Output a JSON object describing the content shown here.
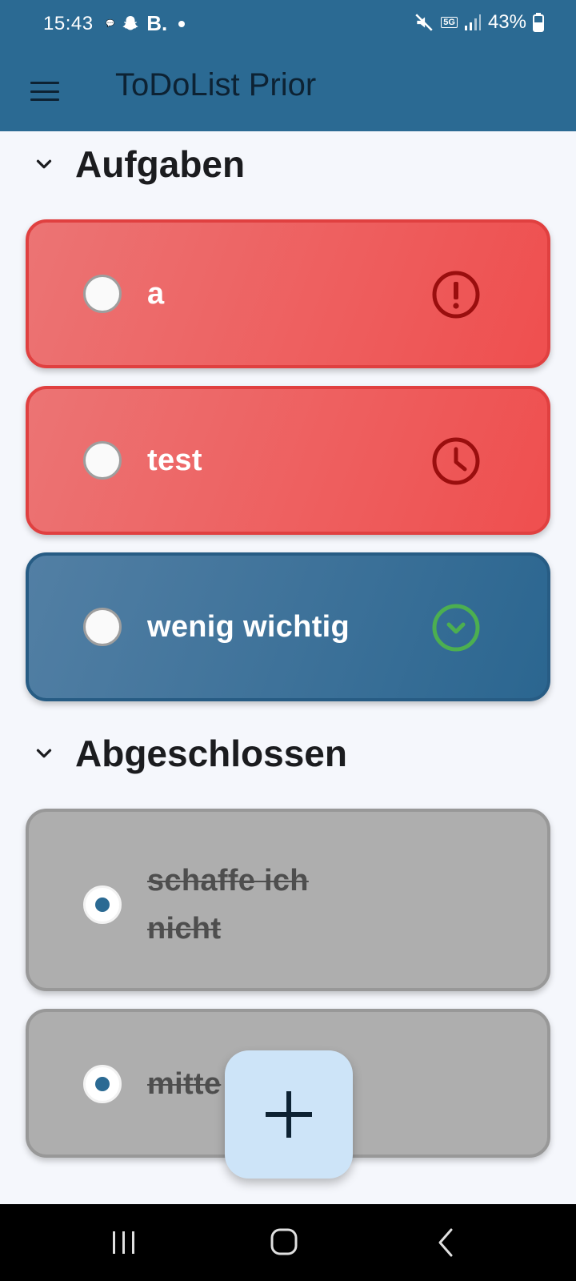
{
  "status_bar": {
    "time": "15:43",
    "left_icons": [
      "chat-icon",
      "snapchat-icon"
    ],
    "b_label": "B.",
    "battery_percent": "43%",
    "network_label": "5G",
    "right_icons": [
      "mute-icon",
      "5g-icon",
      "signal-icon",
      "battery-icon"
    ]
  },
  "app_bar": {
    "title": "ToDoList Prior",
    "menu_icon": "menu-icon"
  },
  "sections": [
    {
      "title": "Aufgaben",
      "expanded": true
    },
    {
      "title": "Abgeschlossen",
      "expanded": true
    }
  ],
  "open_tasks": [
    {
      "label": "a",
      "priority_icon": "alert-icon",
      "color": "#ef5350",
      "checked": false
    },
    {
      "label": "test",
      "priority_icon": "clock-icon",
      "color": "#ef5350",
      "checked": false
    },
    {
      "label": "wenig wichtig",
      "priority_icon": "check-circle-icon",
      "color": "#2b6a93",
      "checked": false
    }
  ],
  "done_tasks": [
    {
      "label": "schaffe ich nicht",
      "checked": true
    },
    {
      "label": "mitte",
      "checked": true
    }
  ],
  "fab": {
    "icon": "plus-icon"
  },
  "nav_bar": {
    "icons": [
      "recents-icon",
      "home-icon",
      "back-icon"
    ]
  },
  "colors": {
    "primary": "#2b6a93",
    "high_priority": "#ef5350",
    "icon_dark_red": "#9a0e0e",
    "low_priority_icon": "#4caf50",
    "done": "#aeaeae",
    "fab": "#cde4f8"
  }
}
